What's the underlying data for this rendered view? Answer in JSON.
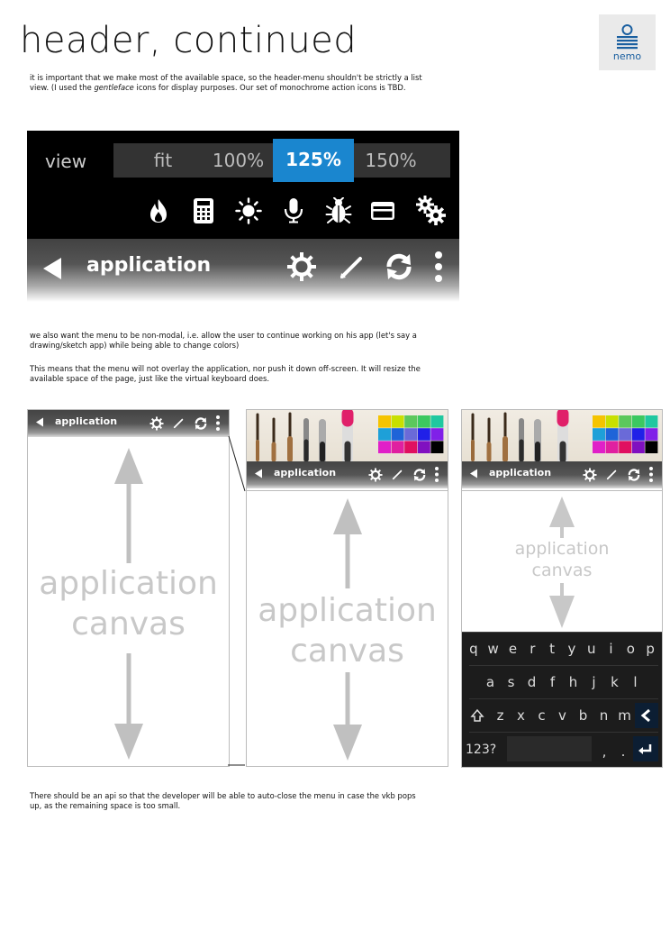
{
  "page": {
    "title": "header, continued",
    "logo_text": "nemo",
    "intro_1": "it is important that we make most of the available space, so the header-menu shouldn't be strictly a list view. (I used the ",
    "intro_em": "gentleface",
    "intro_2": " icons for display purposes. Our set of monochrome action icons is TBD.",
    "para2": "we also want the menu to be non-modal, i.e. allow the user to continue working on his app (let's say a drawing/sketch app) while being able to change colors)",
    "para3": "This means that the menu will not overlay the application, nor push it down off-screen. It will resize the available space of the page, just like the virtual keyboard does.",
    "para4": "There should be an api so that the developer will be able to auto-close the menu in case the vkb pops up, as the remaining space is too small."
  },
  "menu": {
    "view_label": "view",
    "zoom_options": [
      "fit",
      "100%",
      "125%",
      "150%"
    ],
    "selected_zoom": "125%",
    "action_icons": [
      "flame-icon",
      "calculator-icon",
      "brightness-icon",
      "microphone-icon",
      "bug-icon",
      "card-icon",
      "gears-icon"
    ]
  },
  "appbar": {
    "title": "application",
    "icons": [
      "back-icon",
      "settings-icon",
      "pencil-icon",
      "refresh-icon",
      "overflow-icon"
    ]
  },
  "canvas": {
    "label_line1": "application",
    "label_line2": "canvas"
  },
  "keyboard": {
    "row1": [
      "q",
      "w",
      "e",
      "r",
      "t",
      "y",
      "u",
      "i",
      "o",
      "p"
    ],
    "row2": [
      "a",
      "s",
      "d",
      "f",
      "h",
      "j",
      "k",
      "l"
    ],
    "row3": [
      "z",
      "x",
      "c",
      "v",
      "b",
      "n",
      "m"
    ],
    "numbers_key": "123?",
    "comma_key": ",",
    "period_key": "."
  },
  "palette": [
    "#f5c400",
    "#c8e000",
    "#5cc85c",
    "#3cc860",
    "#20c8a0",
    "#1ea0d8",
    "#1e64d8",
    "#6a6ad8",
    "#2020e8",
    "#8020e8",
    "#e020c8",
    "#e020a0",
    "#e01060",
    "#8010c0",
    "#000000"
  ],
  "colors": {
    "accent": "#1a86cf",
    "menu_bg": "#000000",
    "zoom_bg": "#333333"
  }
}
